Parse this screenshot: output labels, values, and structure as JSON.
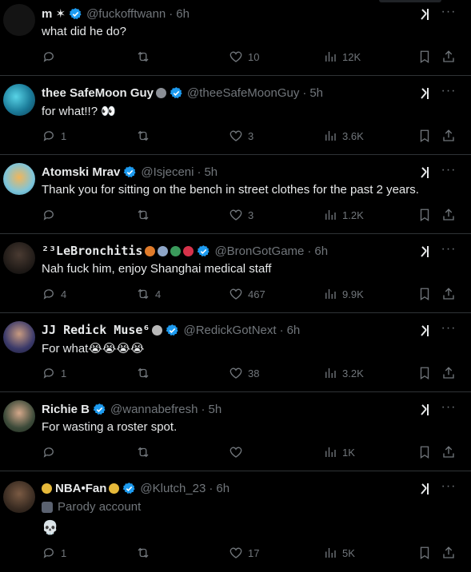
{
  "tweets": [
    {
      "name": "m ✶",
      "handle": "@fuckofftwann",
      "time": "6h",
      "text": "what did he do?",
      "reply": "",
      "repost": "",
      "like": "10",
      "views": "12K"
    },
    {
      "name": "thee SafeMoon Guy",
      "handle": "@theeSafeMoonGuy",
      "time": "5h",
      "text": "for what!!? 👀",
      "reply": "1",
      "repost": "",
      "like": "3",
      "views": "3.6K"
    },
    {
      "name": "Atomski Mrav",
      "handle": "@Isjeceni",
      "time": "5h",
      "text": "Thank you for sitting on the bench in street clothes for the past 2 years.",
      "reply": "",
      "repost": "",
      "like": "3",
      "views": "1.2K"
    },
    {
      "name": "²³LeBronchitis",
      "handle": "@BronGotGame",
      "time": "6h",
      "text": "Nah fuck him, enjoy Shanghai medical staff",
      "reply": "4",
      "repost": "4",
      "like": "467",
      "views": "9.9K"
    },
    {
      "name": "JJ Redick Muse⁶",
      "handle": "@RedickGotNext",
      "time": "6h",
      "text": "For what😭😭😭😭",
      "reply": "1",
      "repost": "",
      "like": "38",
      "views": "3.2K"
    },
    {
      "name": "Richie B",
      "handle": "@wannabefresh",
      "time": "5h",
      "text": "For wasting a roster spot.",
      "reply": "",
      "repost": "",
      "like": "",
      "views": "1K"
    },
    {
      "name": "NBA•Fan",
      "handle": "@Klutch_23",
      "time": "6h",
      "parody": "Parody account",
      "text": "💀",
      "reply": "1",
      "repost": "",
      "like": "17",
      "views": "5K"
    }
  ],
  "icons": {
    "reply": "reply-icon",
    "repost": "repost-icon",
    "like": "heart-icon",
    "views": "views-icon",
    "bookmark": "bookmark-icon",
    "share": "share-icon",
    "grok": "grok-icon",
    "more": "more-icon",
    "verified": "verified-badge-icon"
  },
  "colors": {
    "background": "#000000",
    "text": "#e7e9ea",
    "muted": "#71767b",
    "verified": "#1d9bf0",
    "divider": "#2f3336"
  }
}
